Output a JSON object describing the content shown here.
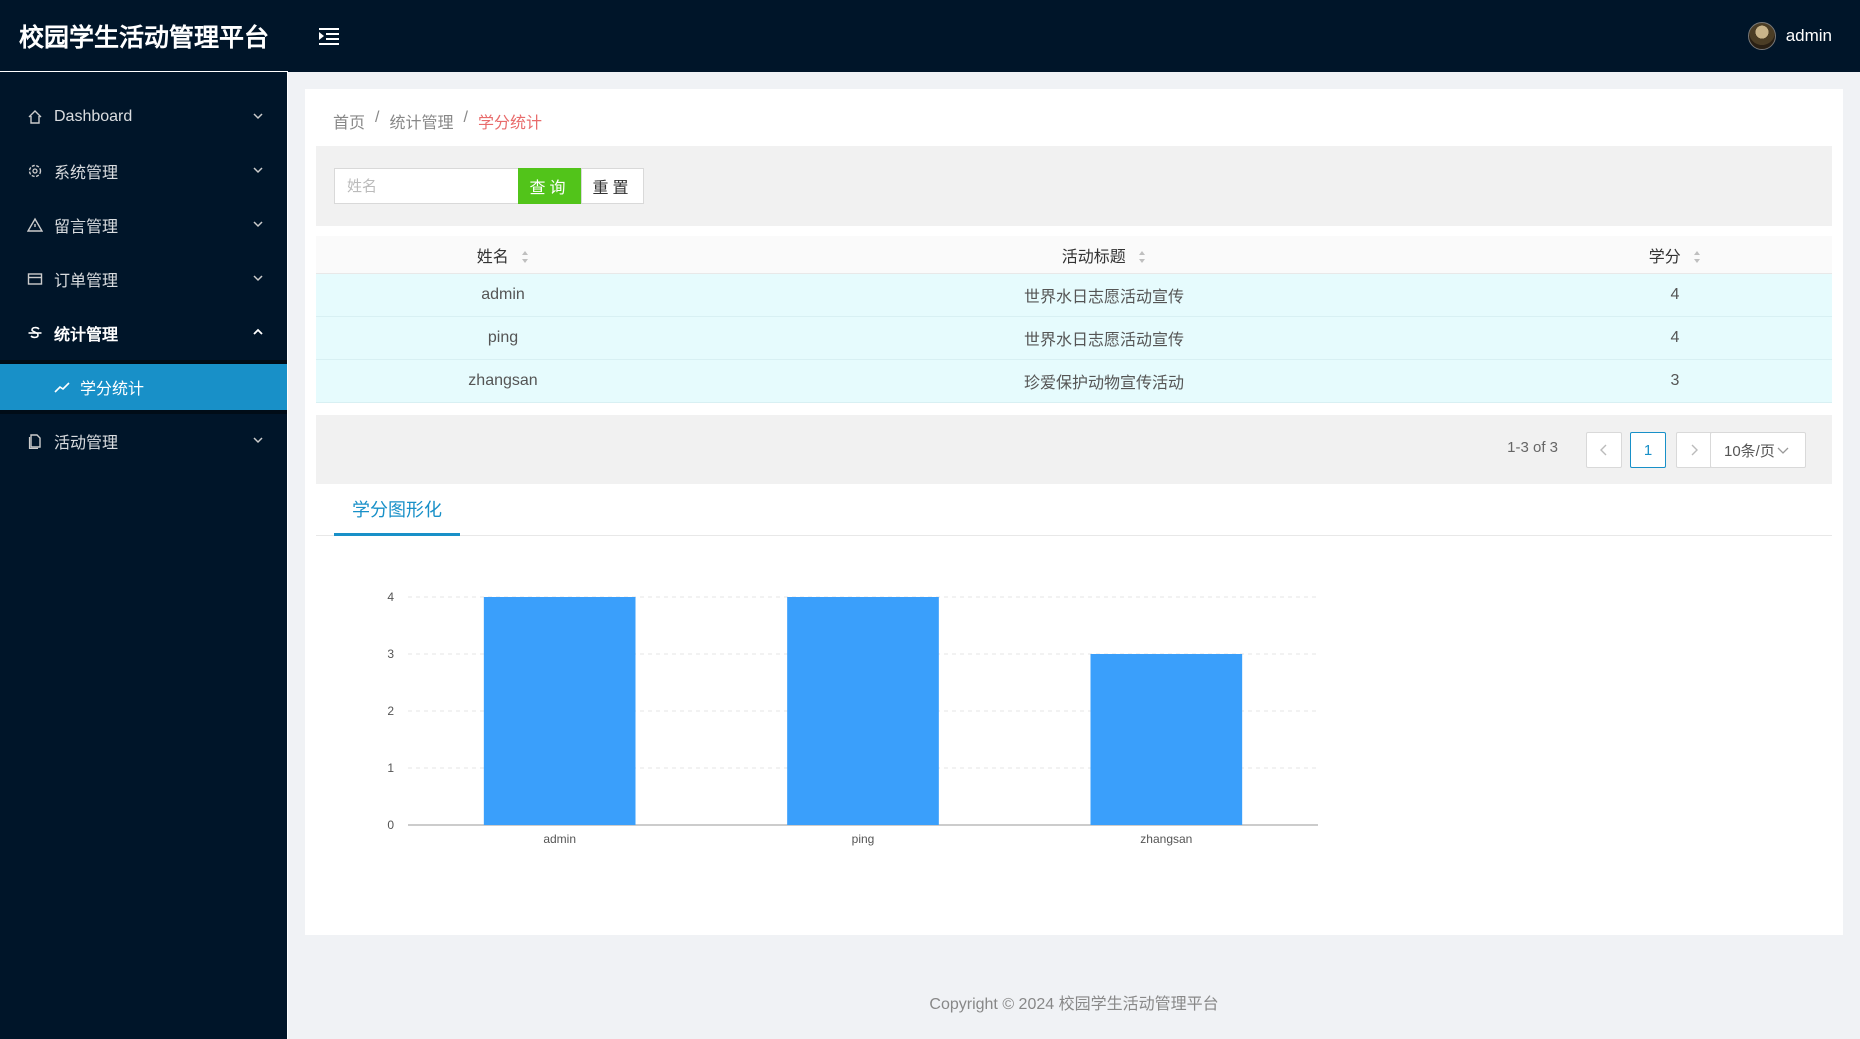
{
  "app": {
    "title": "校园学生活动管理平台"
  },
  "header": {
    "username": "admin"
  },
  "sidebar": {
    "items": [
      {
        "label": "Dashboard",
        "icon": "home-icon"
      },
      {
        "label": "系统管理",
        "icon": "gear-icon"
      },
      {
        "label": "留言管理",
        "icon": "warning-icon"
      },
      {
        "label": "订单管理",
        "icon": "card-icon"
      },
      {
        "label": "统计管理",
        "icon": "strikethrough-icon"
      },
      {
        "label": "活动管理",
        "icon": "document-icon"
      }
    ],
    "subitem": {
      "label": "学分统计",
      "icon": "line-chart-icon"
    }
  },
  "breadcrumb": {
    "home": "首页",
    "parent": "统计管理",
    "current": "学分统计"
  },
  "search": {
    "placeholder": "姓名",
    "query_label": "查询",
    "reset_label": "重置"
  },
  "table": {
    "columns": [
      "姓名",
      "活动标题",
      "学分"
    ],
    "rows": [
      {
        "name": "admin",
        "title": "世界水日志愿活动宣传",
        "credit": "4"
      },
      {
        "name": "ping",
        "title": "世界水日志愿活动宣传",
        "credit": "4"
      },
      {
        "name": "zhangsan",
        "title": "珍爱保护动物宣传活动",
        "credit": "3"
      }
    ]
  },
  "pagination": {
    "total_text": "1-3 of 3",
    "current_page": "1",
    "page_size": "10条/页"
  },
  "tab": {
    "label": "学分图形化"
  },
  "chart_data": {
    "type": "bar",
    "categories": [
      "admin",
      "ping",
      "zhangsan"
    ],
    "values": [
      4,
      4,
      3
    ],
    "ylim": [
      0,
      4
    ],
    "yticks": [
      0,
      1,
      2,
      3,
      4
    ],
    "grid": true,
    "bar_color": "#3a9ffb"
  },
  "footer": {
    "text": "Copyright © 2024 校园学生活动管理平台"
  },
  "colors": {
    "header_bg": "#001529",
    "accent": "#1890c8",
    "query_button": "#52c41a",
    "breadcrumb_active": "#e86b6b"
  }
}
